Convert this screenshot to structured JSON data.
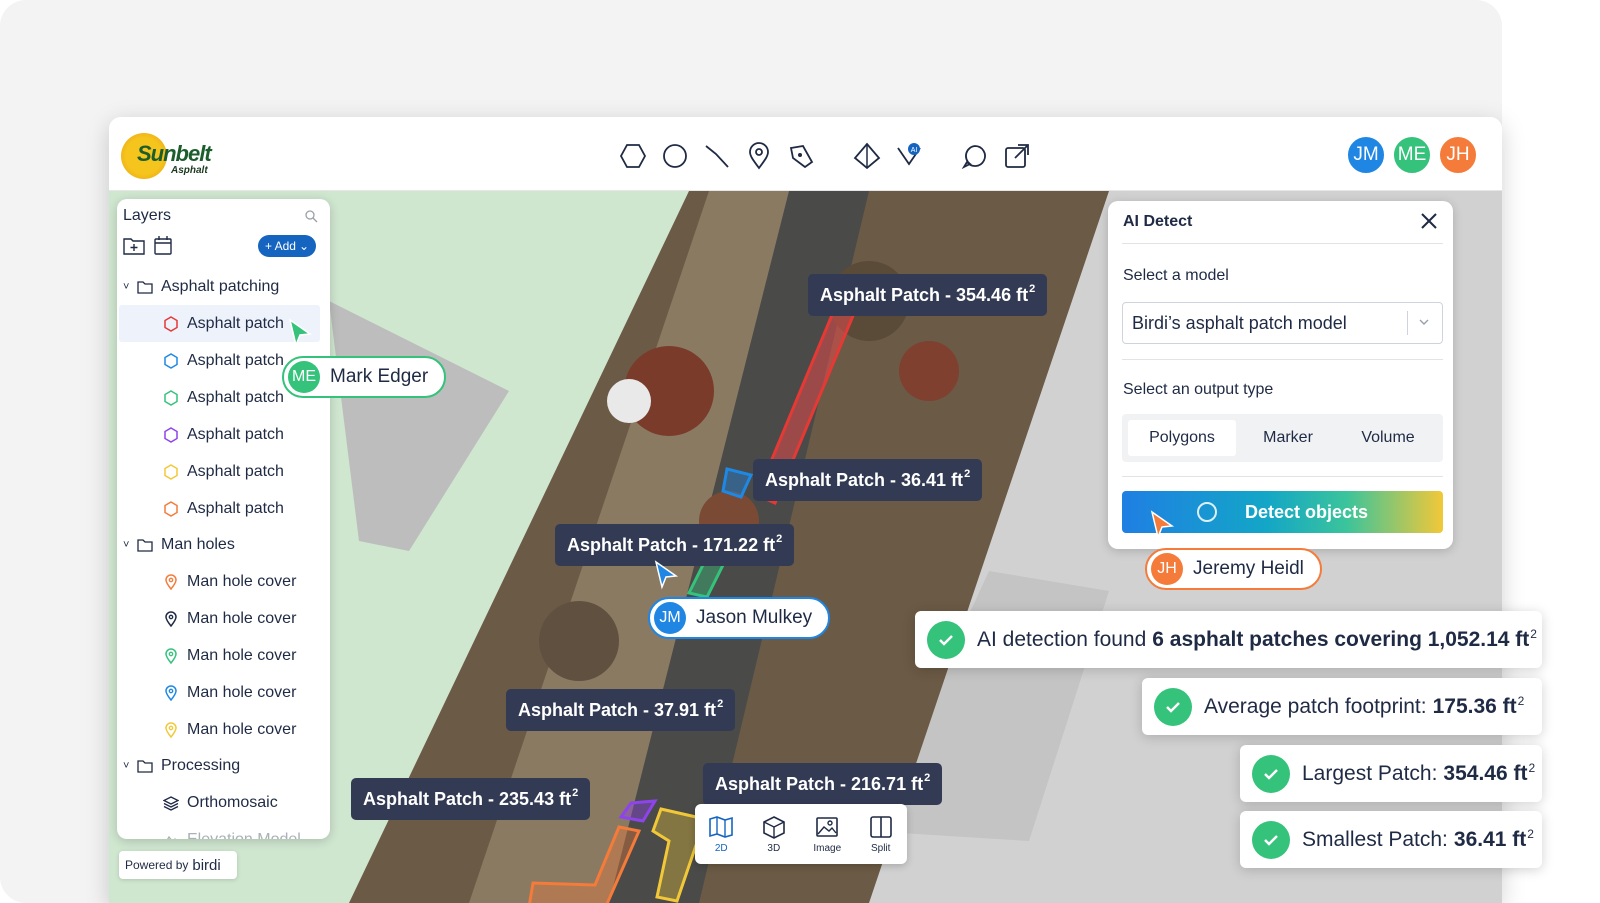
{
  "brand": {
    "name": "Sunbelt",
    "sub": "Asphalt"
  },
  "toolbar_icons": [
    "polygon-icon",
    "circle-icon",
    "line-icon",
    "marker-icon",
    "pen-icon",
    "volume-icon",
    "ai-shield-icon",
    "comment-icon",
    "share-icon"
  ],
  "users": [
    {
      "initials": "JM",
      "name": "Jason Mulkey",
      "color": "#1f86e3"
    },
    {
      "initials": "ME",
      "name": "Mark Edger",
      "color": "#35c27b"
    },
    {
      "initials": "JH",
      "name": "Jeremy Heidl",
      "color": "#f47b3a"
    }
  ],
  "layers": {
    "title": "Layers",
    "add_label": "+ Add",
    "groups": [
      {
        "label": "Asphalt patching",
        "items": [
          {
            "label": "Asphalt patch",
            "color": "#e53935"
          },
          {
            "label": "Asphalt patch",
            "color": "#1e88e5"
          },
          {
            "label": "Asphalt patch",
            "color": "#35c27b"
          },
          {
            "label": "Asphalt patch",
            "color": "#8e44ec"
          },
          {
            "label": "Asphalt patch",
            "color": "#f2c838"
          },
          {
            "label": "Asphalt patch",
            "color": "#f47b3a"
          }
        ]
      },
      {
        "label": "Man holes",
        "items": [
          {
            "label": "Man hole cover",
            "color": "#f47b3a"
          },
          {
            "label": "Man hole cover",
            "color": "#1f2a44"
          },
          {
            "label": "Man hole cover",
            "color": "#35c27b"
          },
          {
            "label": "Man hole cover",
            "color": "#1e88e5"
          },
          {
            "label": "Man hole cover",
            "color": "#f2c838"
          }
        ]
      },
      {
        "label": "Processing",
        "items": [
          {
            "label": "Orthomosaic"
          },
          {
            "label": "Elevation Model"
          }
        ]
      }
    ],
    "powered_by": "Powered by",
    "powered_brand": "birdi"
  },
  "ai_detect": {
    "title": "AI Detect",
    "model_label": "Select a model",
    "model_value": "Birdi’s asphalt patch model",
    "output_label": "Select an output type",
    "output_options": [
      "Polygons",
      "Marker",
      "Volume"
    ],
    "output_selected": "Polygons",
    "detect_label": "Detect objects"
  },
  "patch_tags": [
    {
      "label": "Asphalt Patch - 354.46 ft"
    },
    {
      "label": "Asphalt Patch - 36.41 ft"
    },
    {
      "label": "Asphalt Patch - 171.22 ft"
    },
    {
      "label": "Asphalt Patch - 37.91 ft"
    },
    {
      "label": "Asphalt Patch - 216.71 ft"
    },
    {
      "label": "Asphalt Patch - 235.43 ft"
    }
  ],
  "superscript": "2",
  "view_modes": [
    {
      "label": "2D",
      "active": true
    },
    {
      "label": "3D",
      "active": false
    },
    {
      "label": "Image",
      "active": false
    },
    {
      "label": "Split",
      "active": false
    }
  ],
  "toasts": [
    {
      "prefix": "AI detection found",
      "value": "6 asphalt patches covering 1,052.14 ft"
    },
    {
      "prefix": "Average patch footprint:",
      "value": "175.36 ft"
    },
    {
      "prefix": "Largest Patch:",
      "value": "354.46 ft"
    },
    {
      "prefix": "Smallest Patch:",
      "value": "36.41 ft"
    }
  ]
}
